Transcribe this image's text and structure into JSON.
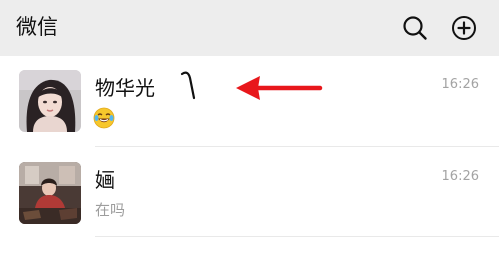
{
  "header": {
    "title": "微信",
    "search_icon": "search-icon",
    "add_icon": "plus-circle-icon"
  },
  "chats": [
    {
      "name": "物华光",
      "preview_icon": "laughing-tears-emoji",
      "time": "16:26"
    },
    {
      "name": "婳",
      "preview": "在吗",
      "time": "16:26"
    }
  ],
  "annotation": {
    "arrow_color": "#e8171b",
    "stroke_icon": "brush-stroke-icon"
  }
}
